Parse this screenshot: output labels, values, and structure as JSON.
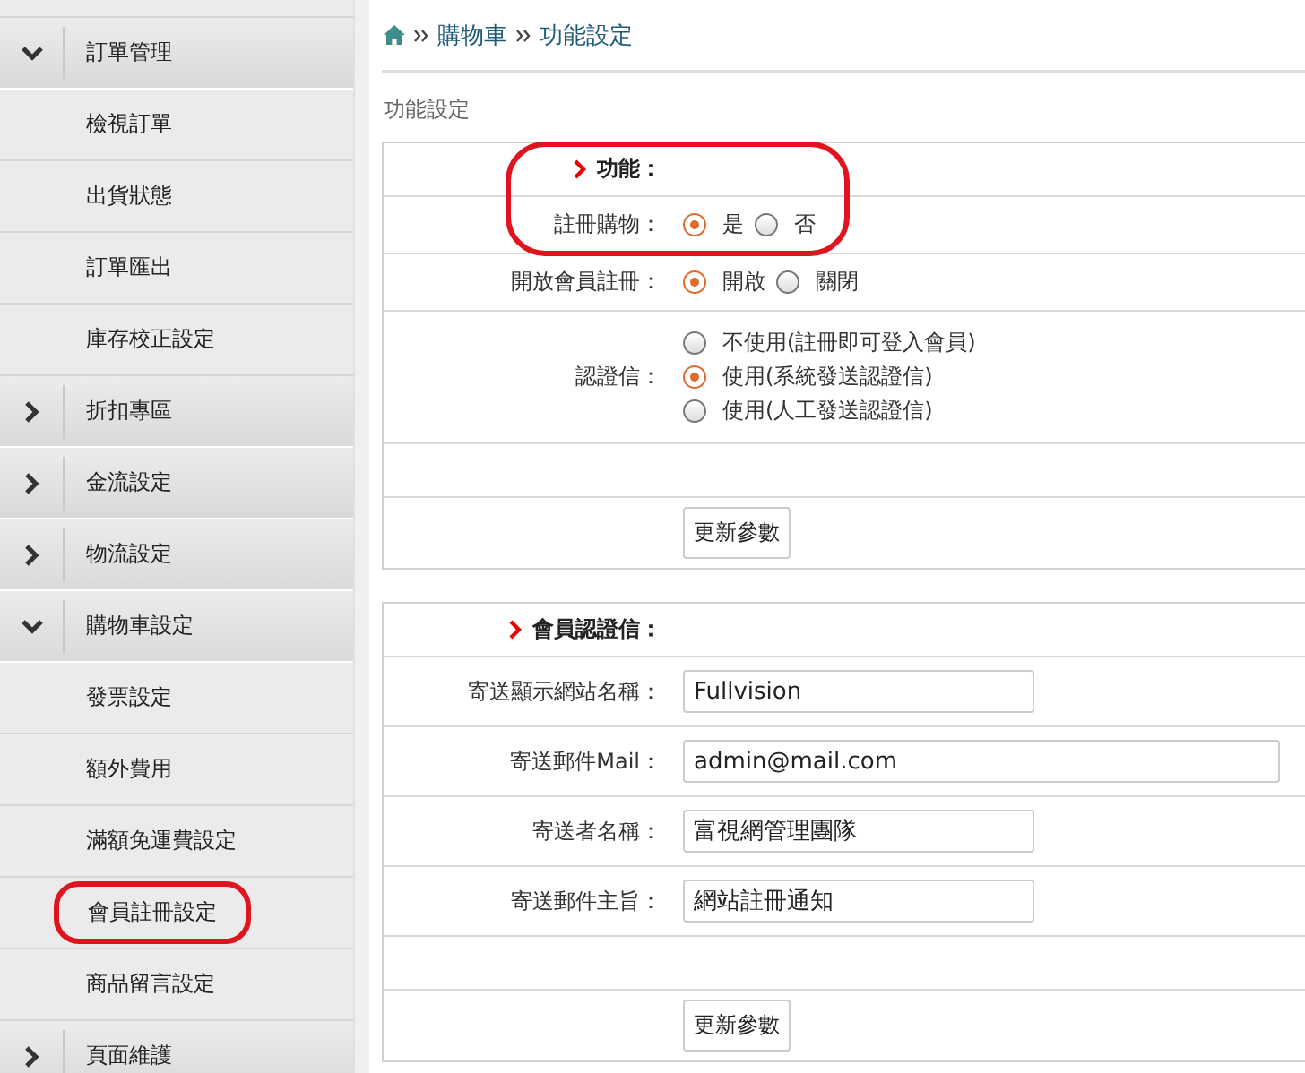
{
  "sidebar": {
    "items": [
      {
        "label": "訂單管理",
        "expanded": true,
        "children": [
          {
            "label": "檢視訂單",
            "highlighted": false
          },
          {
            "label": "出貨狀態",
            "highlighted": false
          },
          {
            "label": "訂單匯出",
            "highlighted": false
          },
          {
            "label": "庫存校正設定",
            "highlighted": false
          }
        ]
      },
      {
        "label": "折扣專區",
        "expanded": false
      },
      {
        "label": "金流設定",
        "expanded": false
      },
      {
        "label": "物流設定",
        "expanded": false
      },
      {
        "label": "購物車設定",
        "expanded": true,
        "children": [
          {
            "label": "發票設定",
            "highlighted": false
          },
          {
            "label": "額外費用",
            "highlighted": false
          },
          {
            "label": "滿額免運費設定",
            "highlighted": false
          },
          {
            "label": "會員註冊設定",
            "highlighted": true
          },
          {
            "label": "商品留言設定",
            "highlighted": false
          }
        ]
      },
      {
        "label": "頁面維護",
        "expanded": false
      }
    ]
  },
  "breadcrumb": [
    "購物車",
    "功能設定"
  ],
  "page_heading": "功能設定",
  "panels": [
    {
      "heading": "功能：",
      "highlighted": true,
      "rows": [
        {
          "kind": "radio",
          "label": "註冊購物：",
          "options": [
            {
              "label": "是",
              "selected": true
            },
            {
              "label": "否",
              "selected": false
            }
          ]
        },
        {
          "kind": "radio",
          "label": "開放會員註冊：",
          "options": [
            {
              "label": "開啟",
              "selected": true
            },
            {
              "label": "關閉",
              "selected": false
            }
          ]
        },
        {
          "kind": "radio_list",
          "label": "認證信：",
          "options": [
            {
              "label": "不使用(註冊即可登入會員)",
              "selected": false
            },
            {
              "label": "使用(系統發送認證信)",
              "selected": true
            },
            {
              "label": "使用(人工發送認證信)",
              "selected": false
            }
          ]
        },
        {
          "kind": "empty"
        },
        {
          "kind": "button",
          "label": "更新參數"
        }
      ]
    },
    {
      "heading": "會員認證信：",
      "highlighted": false,
      "rows": [
        {
          "kind": "text",
          "label": "寄送顯示網站名稱：",
          "value": "Fullvision",
          "wide": false
        },
        {
          "kind": "text",
          "label": "寄送郵件Mail：",
          "value": "admin@mail.com",
          "wide": true
        },
        {
          "kind": "text",
          "label": "寄送者名稱：",
          "value": "富視網管理團隊",
          "wide": false
        },
        {
          "kind": "text",
          "label": "寄送郵件主旨：",
          "value": "網站註冊通知",
          "wide": false
        },
        {
          "kind": "empty"
        },
        {
          "kind": "button",
          "label": "更新參數"
        }
      ]
    }
  ]
}
